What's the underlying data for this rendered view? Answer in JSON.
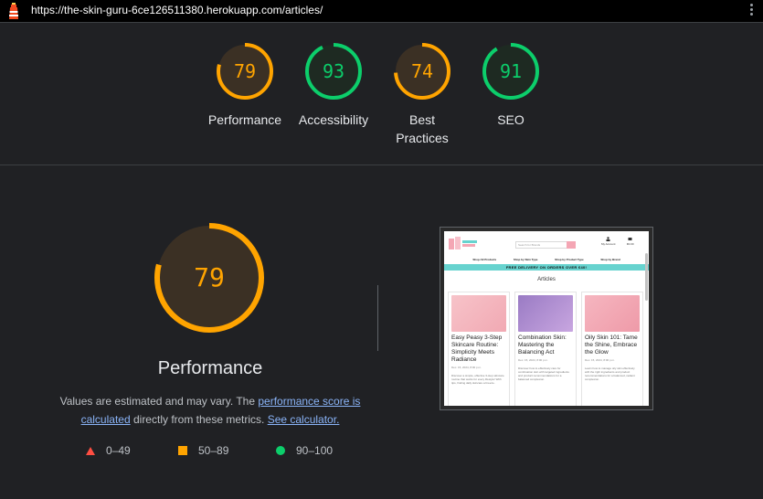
{
  "browser": {
    "url": "https://the-skin-guru-6ce126511380.herokuapp.com/articles/",
    "logo_icon": "lighthouse-icon",
    "menu_icon": "kebab-menu-icon"
  },
  "scores": [
    {
      "value": 79,
      "label": "Performance",
      "status": "average"
    },
    {
      "value": 93,
      "label": "Accessibility",
      "status": "pass"
    },
    {
      "value": 74,
      "label": "Best Practices",
      "status": "average"
    },
    {
      "value": 91,
      "label": "SEO",
      "status": "pass"
    }
  ],
  "colors": {
    "pass": "#0cce6b",
    "pass_text": "#0cce6b",
    "average": "#ffa400",
    "average_text": "#ffa400",
    "fail": "#ff4e42",
    "average_bg": "#3b3024",
    "pass_bg": "#1e2a22"
  },
  "main": {
    "score": 79,
    "title": "Performance",
    "desc_prefix": "Values are estimated and may vary. The ",
    "desc_link1": "performance score is calculated",
    "desc_middle": " directly from these metrics. ",
    "desc_link2": "See calculator."
  },
  "legend": [
    {
      "icon": "triangle-fail-icon",
      "range": "0–49"
    },
    {
      "icon": "square-average-icon",
      "range": "50–89"
    },
    {
      "icon": "circle-pass-icon",
      "range": "90–100"
    }
  ],
  "screenshot": {
    "search_placeholder": "Search for Brands",
    "account": "My Account",
    "bag": "€0.00",
    "nav": [
      "Shop All Products",
      "Shop by Skin Type",
      "Shop by Product Type",
      "Shop by Brand"
    ],
    "banner": "FREE DELIVERY ON ORDERS OVER €40!",
    "title": "Articles",
    "cards": [
      {
        "title": "Easy Peasy 3-Step Skincare Routine: Simplicity Meets Radiance",
        "date": "Dec. 15, 2024, 8:00 p.m.",
        "text": "Discover a simple, effective 3-step skincare routine that works for every lifestyle! With tips, finding daily skincare a breeze."
      },
      {
        "title": "Combination Skin: Mastering the Balancing Act",
        "date": "Dec. 15, 2024, 8:00 p.m.",
        "text": "Discover how to effectively care for combination skin with targeted ingredients and product recommendations for a balanced complexion."
      },
      {
        "title": "Oily Skin 101: Tame the Shine, Embrace the Glow",
        "date": "Dec. 15, 2024, 8:00 p.m.",
        "text": "Learn how to manage oily skin effectively with the right ingredients and product recommendations for a balanced, radiant complexion."
      }
    ]
  }
}
